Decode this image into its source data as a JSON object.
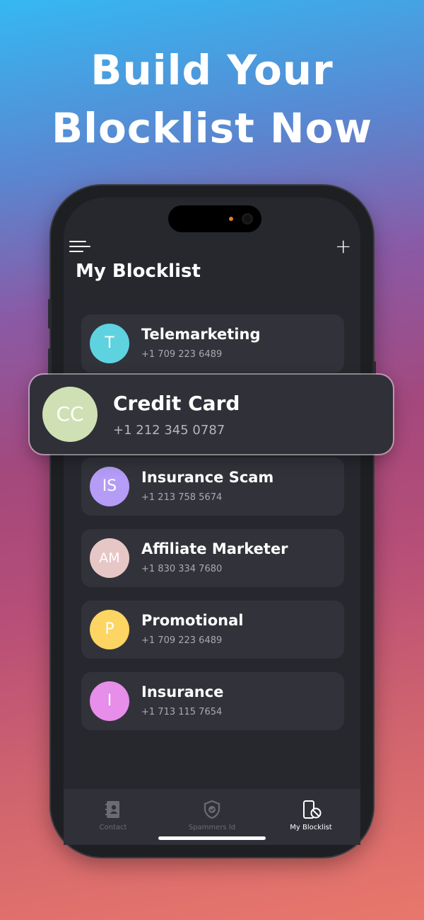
{
  "promo": {
    "headline_line1": "Build Your",
    "headline_line2": "Blocklist Now"
  },
  "header": {
    "title": "My Blocklist",
    "menu_icon": "hamburger-icon",
    "add_icon": "plus-icon"
  },
  "featured": {
    "initials": "CC",
    "name": "Credit Card",
    "phone": "+1 212 345 0787",
    "color": "#cfe0b4"
  },
  "contacts": [
    {
      "initials": "T",
      "name": "Telemarketing",
      "phone": "+1 709 223 6489",
      "color": "#5fd2e0"
    },
    {
      "initials": "IS",
      "name": "Insurance Scam",
      "phone": "+1 213 758 5674",
      "color": "#b49cf7"
    },
    {
      "initials": "AM",
      "name": "Affiliate Marketer",
      "phone": "+1 830 334 7680",
      "color": "#e7c7c6"
    },
    {
      "initials": "P",
      "name": "Promotional",
      "phone": "+1 709 223 6489",
      "color": "#fcd562"
    },
    {
      "initials": "I",
      "name": "Insurance",
      "phone": "+1 713 115 7654",
      "color": "#e68ee9"
    }
  ],
  "tabs": [
    {
      "label": "Contact",
      "icon": "contact-book-icon",
      "active": false
    },
    {
      "label": "Spammers Id",
      "icon": "shield-check-icon",
      "active": false
    },
    {
      "label": "My Blocklist",
      "icon": "phone-block-icon",
      "active": true
    }
  ],
  "colors": {
    "inactive_tab": "#6b6c73",
    "active_tab": "#ffffff"
  }
}
